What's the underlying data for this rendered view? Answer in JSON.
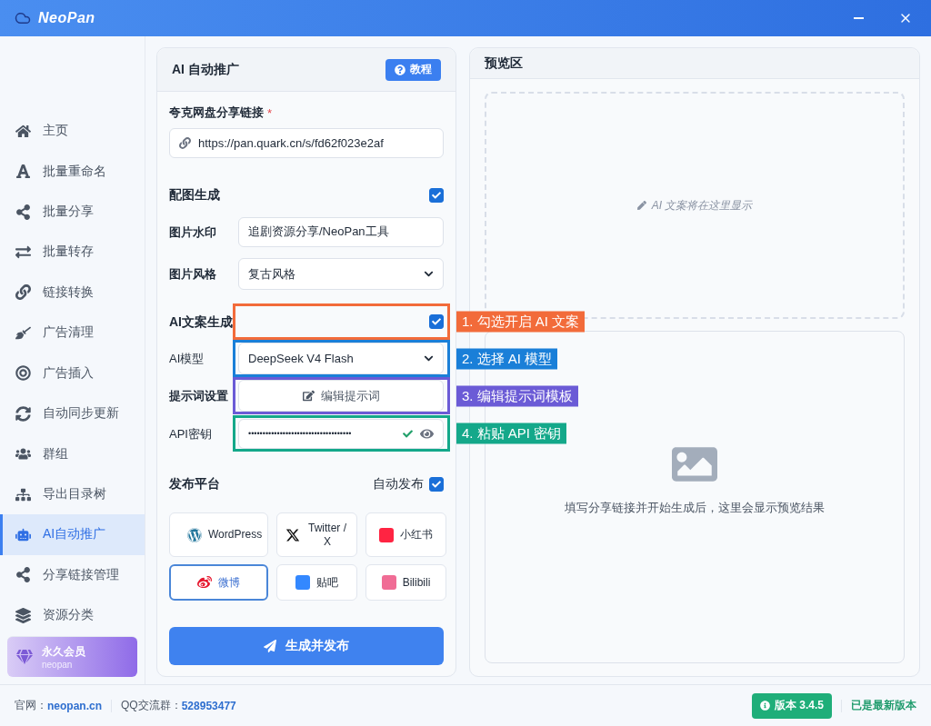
{
  "window": {
    "title": "NeoPan"
  },
  "sidebar": {
    "items": [
      {
        "label": "主页",
        "selected": false
      },
      {
        "label": "批量重命名",
        "selected": false
      },
      {
        "label": "批量分享",
        "selected": false
      },
      {
        "label": "批量转存",
        "selected": false
      },
      {
        "label": "链接转换",
        "selected": false
      },
      {
        "label": "广告清理",
        "selected": false
      },
      {
        "label": "广告插入",
        "selected": false
      },
      {
        "label": "自动同步更新",
        "selected": false
      },
      {
        "label": "群组",
        "selected": false
      },
      {
        "label": "导出目录树",
        "selected": false
      },
      {
        "label": "AI自动推广",
        "selected": true
      },
      {
        "label": "分享链接管理",
        "selected": false
      },
      {
        "label": "资源分类",
        "selected": false
      }
    ],
    "member": {
      "title": "永久会员",
      "subtitle": "neopan"
    }
  },
  "form": {
    "title": "AI 自动推广",
    "help_button": "教程",
    "link": {
      "label": "夸克网盘分享链接",
      "required_mark": "*",
      "value": "https://pan.quark.cn/s/fd62f023e2af"
    },
    "image_gen": {
      "label": "配图生成",
      "checked": true
    },
    "watermark": {
      "label": "图片水印",
      "value": "追剧资源分享/NeoPan工具"
    },
    "style": {
      "label": "图片风格",
      "value": "复古风格"
    },
    "ai_copy": {
      "label": "AI文案生成",
      "checked": true,
      "annotation": {
        "text": "1. 勾选开启 AI 文案",
        "color": "#f26b3a"
      }
    },
    "model": {
      "label": "AI模型",
      "value": "DeepSeek V4 Flash",
      "annotation": {
        "text": "2. 选择 AI 模型",
        "color": "#1a7fd8"
      }
    },
    "prompt": {
      "label": "提示词设置",
      "button": "编辑提示词",
      "annotation": {
        "text": "3. 编辑提示词模板",
        "color": "#6b5bd6"
      }
    },
    "api_key": {
      "label": "API密钥",
      "value": "••••••••••••••••••••••••••••••••••••",
      "valid": true,
      "annotation": {
        "text": "4. 粘贴 API 密钥",
        "color": "#14a88a"
      }
    },
    "publish": {
      "label": "发布平台",
      "auto_publish": {
        "label": "自动发布",
        "checked": true
      },
      "platforms": [
        {
          "label": "WordPress",
          "selected": false
        },
        {
          "label": "Twitter / X",
          "selected": false
        },
        {
          "label": "小红书",
          "selected": false
        },
        {
          "label": "微博",
          "selected": true
        },
        {
          "label": "贴吧",
          "selected": false
        },
        {
          "label": "Bilibili",
          "selected": false
        }
      ]
    },
    "submit": "生成并发布"
  },
  "preview": {
    "title": "预览区",
    "text_placeholder": "AI 文案将在这里显示",
    "image_hint": "填写分享链接并开始生成后，这里会显示预览结果"
  },
  "footer": {
    "site_label": "官网：",
    "site": "neopan.cn",
    "qq_label": "QQ交流群：",
    "qq": "528953477",
    "version": "版本 3.4.5",
    "status": "已是最新版本"
  }
}
